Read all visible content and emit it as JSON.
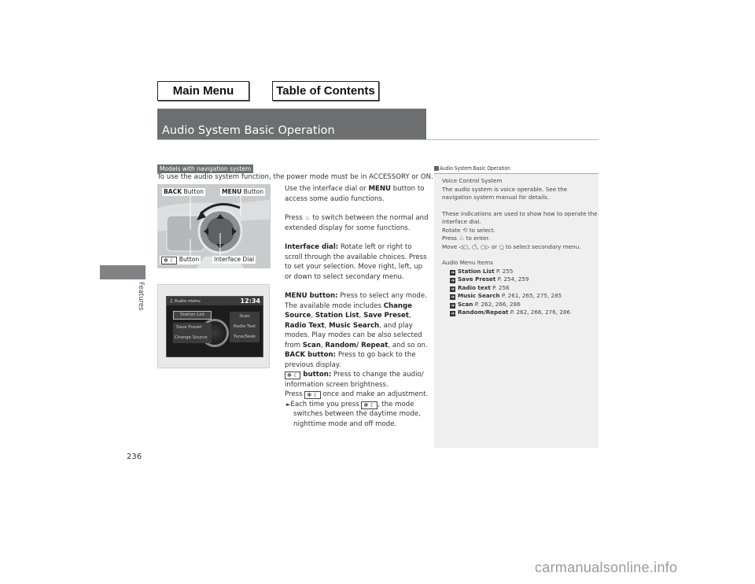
{
  "nav": {
    "main_menu": "Main Menu",
    "table_of_contents": "Table of Contents"
  },
  "page": {
    "title": "Audio System Basic Operation",
    "section_tab": "Features",
    "page_number": "236"
  },
  "main": {
    "badge": "Models with navigation system",
    "intro": "To use the audio system function, the power mode must be in ACCESSORY or ON.",
    "figure1": {
      "callouts": {
        "back_bold": "BACK",
        "back_rest": " Button",
        "menu_bold": "MENU",
        "menu_rest": " Button",
        "brightness_icon": "✻ ☾",
        "brightness_rest": " Button",
        "dial": "Interface Dial"
      }
    },
    "figure2": {
      "header_icon": "♫",
      "header_title": "Audio menu",
      "clock": "12:34",
      "items_left": [
        "Station List",
        "Save Preset",
        "Change Source"
      ],
      "items_right": [
        "Scan",
        "Radio Text",
        "Tune/Seek"
      ]
    },
    "paragraphs": {
      "p1_a": "Use the interface dial or ",
      "p1_bold": "MENU",
      "p1_b": " button to access some audio functions.",
      "p2_a": "Press ",
      "p2_icon": "♨",
      "p2_b": " to switch between the normal and extended display for some functions.",
      "p3_bold": "Interface dial:",
      "p3_text": " Rotate left or right to scroll through the available choices. Press to set your selection. Move right, left, up or down to select secondary menu.",
      "p4_bold": "MENU button:",
      "p4_a": " Press to select any mode. The available mode includes ",
      "p4_b1": "Change Source",
      "p4_c1": ", ",
      "p4_b2": "Station List",
      "p4_c2": ", ",
      "p4_b3": "Save Preset",
      "p4_c3": ", ",
      "p4_b4": "Radio Text",
      "p4_c4": ", ",
      "p4_b5": "Music Search",
      "p4_d": ", and play modes. Play modes can be also selected from ",
      "p4_b6": "Scan",
      "p4_c6": ", ",
      "p4_b7": "Random/ Repeat",
      "p4_e": ", and so on.",
      "p5_bold": "BACK button:",
      "p5_text": " Press to go back to the previous display.",
      "p6_icon": "✻ ☾",
      "p6_bold": " button:",
      "p6_text": " Press to change the audio/ information screen brightness.",
      "p7_a": "Press ",
      "p7_icon": "✻ ☾",
      "p7_b": " once and make an adjustment.",
      "p8_arrow": "►",
      "p8_a": "Each time you press ",
      "p8_icon": "✻ ☾",
      "p8_b": ", the mode switches between the daytime mode, nighttime mode and off mode."
    }
  },
  "sidebar": {
    "heading": "Audio System Basic Operation",
    "voice_title": "Voice Control System",
    "voice_text": "The audio system is voice operable. See the navigation system manual for details.",
    "indications_text": "These indications are used to show how to operate the interface dial.",
    "rotate_a": "Rotate ",
    "rotate_icon": "⟲",
    "rotate_b": " to select.",
    "press_a": "Press ",
    "press_icon": "♨",
    "press_b": " to enter.",
    "move_text": "Move ◁○, ○̂, ○▷ or ○̬ to select secondary menu.",
    "menu_items_title": "Audio Menu Items",
    "refs": [
      {
        "label": "Station List",
        "pages": " P. 255"
      },
      {
        "label": "Save Preset",
        "pages": " P. 254, 259"
      },
      {
        "label": "Radio text",
        "pages": " P. 256"
      },
      {
        "label": "Music Search",
        "pages": " P. 261, 265, 275, 285"
      },
      {
        "label": "Scan",
        "pages": " P. 262, 266, 286"
      },
      {
        "label": "Random/Repeat",
        "pages": " P. 262, 266, 276, 286"
      }
    ]
  },
  "watermark": "carmanualsonline.info"
}
